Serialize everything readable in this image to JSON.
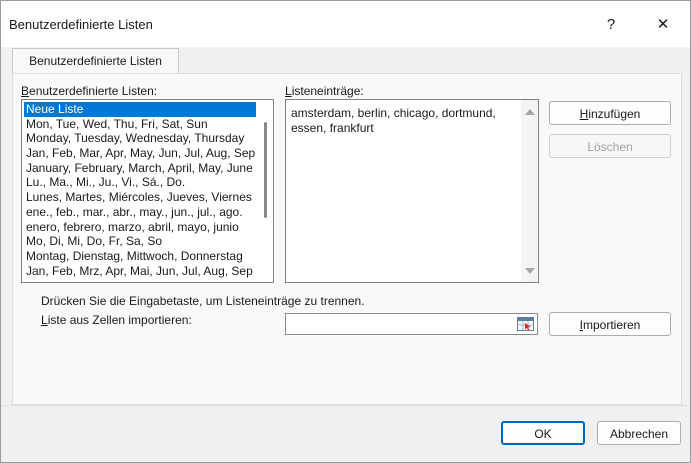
{
  "window": {
    "title": "Benutzerdefinierte Listen",
    "help_glyph": "?",
    "close_glyph": "✕"
  },
  "tab": {
    "label": "Benutzerdefinierte Listen"
  },
  "custom_lists": {
    "label_prefix": "",
    "label_accel": "B",
    "label_rest": "enutzerdefinierte Listen:",
    "items": [
      "Neue Liste",
      "Mon, Tue, Wed, Thu, Fri, Sat, Sun",
      "Monday, Tuesday, Wednesday, Thursday",
      "Jan, Feb, Mar, Apr, May, Jun, Jul, Aug, Sep",
      "January, February, March, April, May, June",
      "Lu., Ma., Mi., Ju., Vi., Sá., Do.",
      "Lunes, Martes, Miércoles, Jueves, Viernes",
      "ene., feb., mar., abr., may., jun., jul., ago.",
      "enero, febrero, marzo, abril, mayo, junio",
      "Mo, Di, Mi, Do, Fr, Sa, So",
      "Montag, Dienstag, Mittwoch, Donnerstag",
      "Jan, Feb, Mrz, Apr, Mai, Jun, Jul, Aug, Sep"
    ],
    "selected_index": 0
  },
  "entries": {
    "label_prefix": "",
    "label_accel": "L",
    "label_rest": "isteneinträge:",
    "value": "amsterdam, berlin, chicago, dortmund,\nessen, frankfurt"
  },
  "buttons": {
    "add": {
      "accel": "H",
      "rest": "inzufügen"
    },
    "delete": {
      "label": "Löschen"
    },
    "import": {
      "accel": "I",
      "rest": "mportieren"
    },
    "ok": {
      "label": "OK"
    },
    "cancel": {
      "label": "Abbrechen"
    }
  },
  "hint_text": "Drücken Sie die Eingabetaste, um Listeneinträge zu trennen.",
  "import_label": {
    "accel": "L",
    "rest": "iste aus Zellen importieren:"
  },
  "import_field": {
    "value": ""
  },
  "colors": {
    "selection": "#0078d7",
    "primary_border": "#0067c0"
  }
}
